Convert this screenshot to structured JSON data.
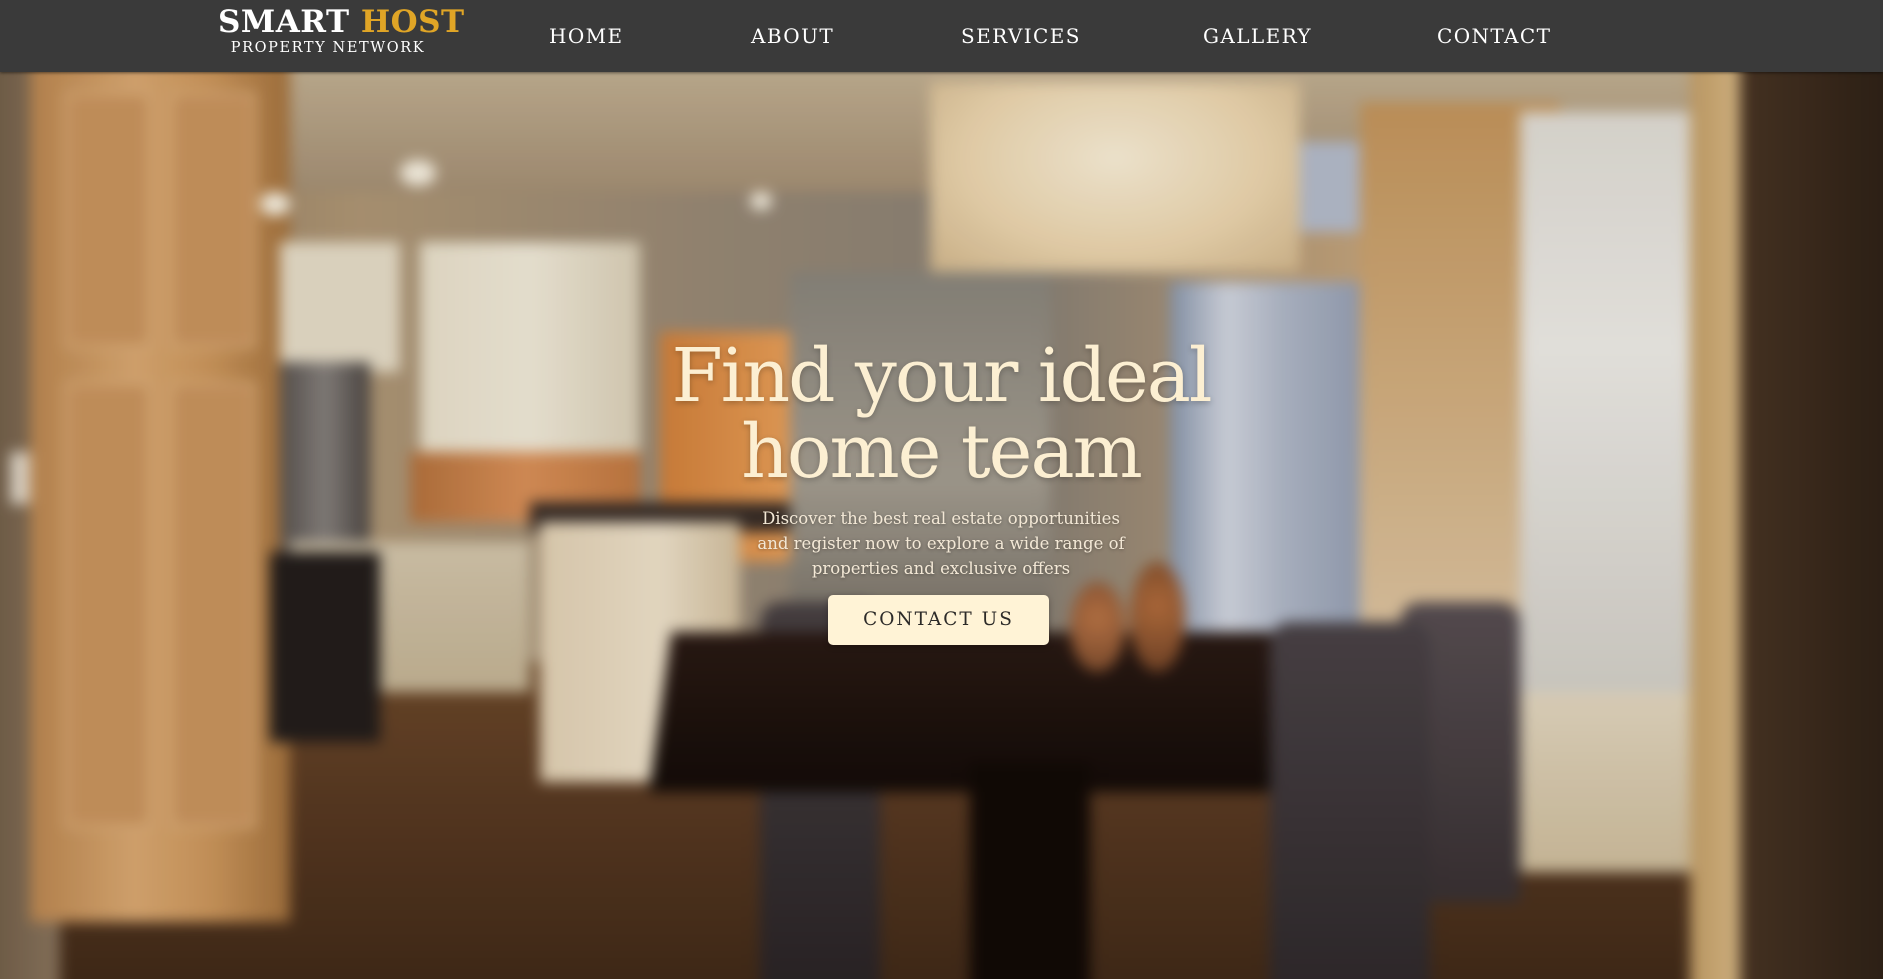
{
  "logo": {
    "word1": "SMART",
    "word2": "HOST",
    "tagline": "PROPERTY NETWORK"
  },
  "nav": {
    "items": [
      {
        "label": "HOME"
      },
      {
        "label": "ABOUT"
      },
      {
        "label": "SERVICES"
      },
      {
        "label": "GALLERY"
      },
      {
        "label": "CONTACT"
      }
    ]
  },
  "hero": {
    "title_line1": "Find your ideal",
    "title_line2": "home team",
    "subtitle_line1": "Discover the best real estate opportunities",
    "subtitle_line2": "and register now to explore a wide range of",
    "subtitle_line3": "properties and exclusive offers",
    "cta_label": "CONTACT US"
  },
  "colors": {
    "navbar_bg": "#3a3a3a",
    "brand_accent": "#e0a526",
    "hero_title": "#fcefd2",
    "cta_bg": "#fff3d6"
  }
}
